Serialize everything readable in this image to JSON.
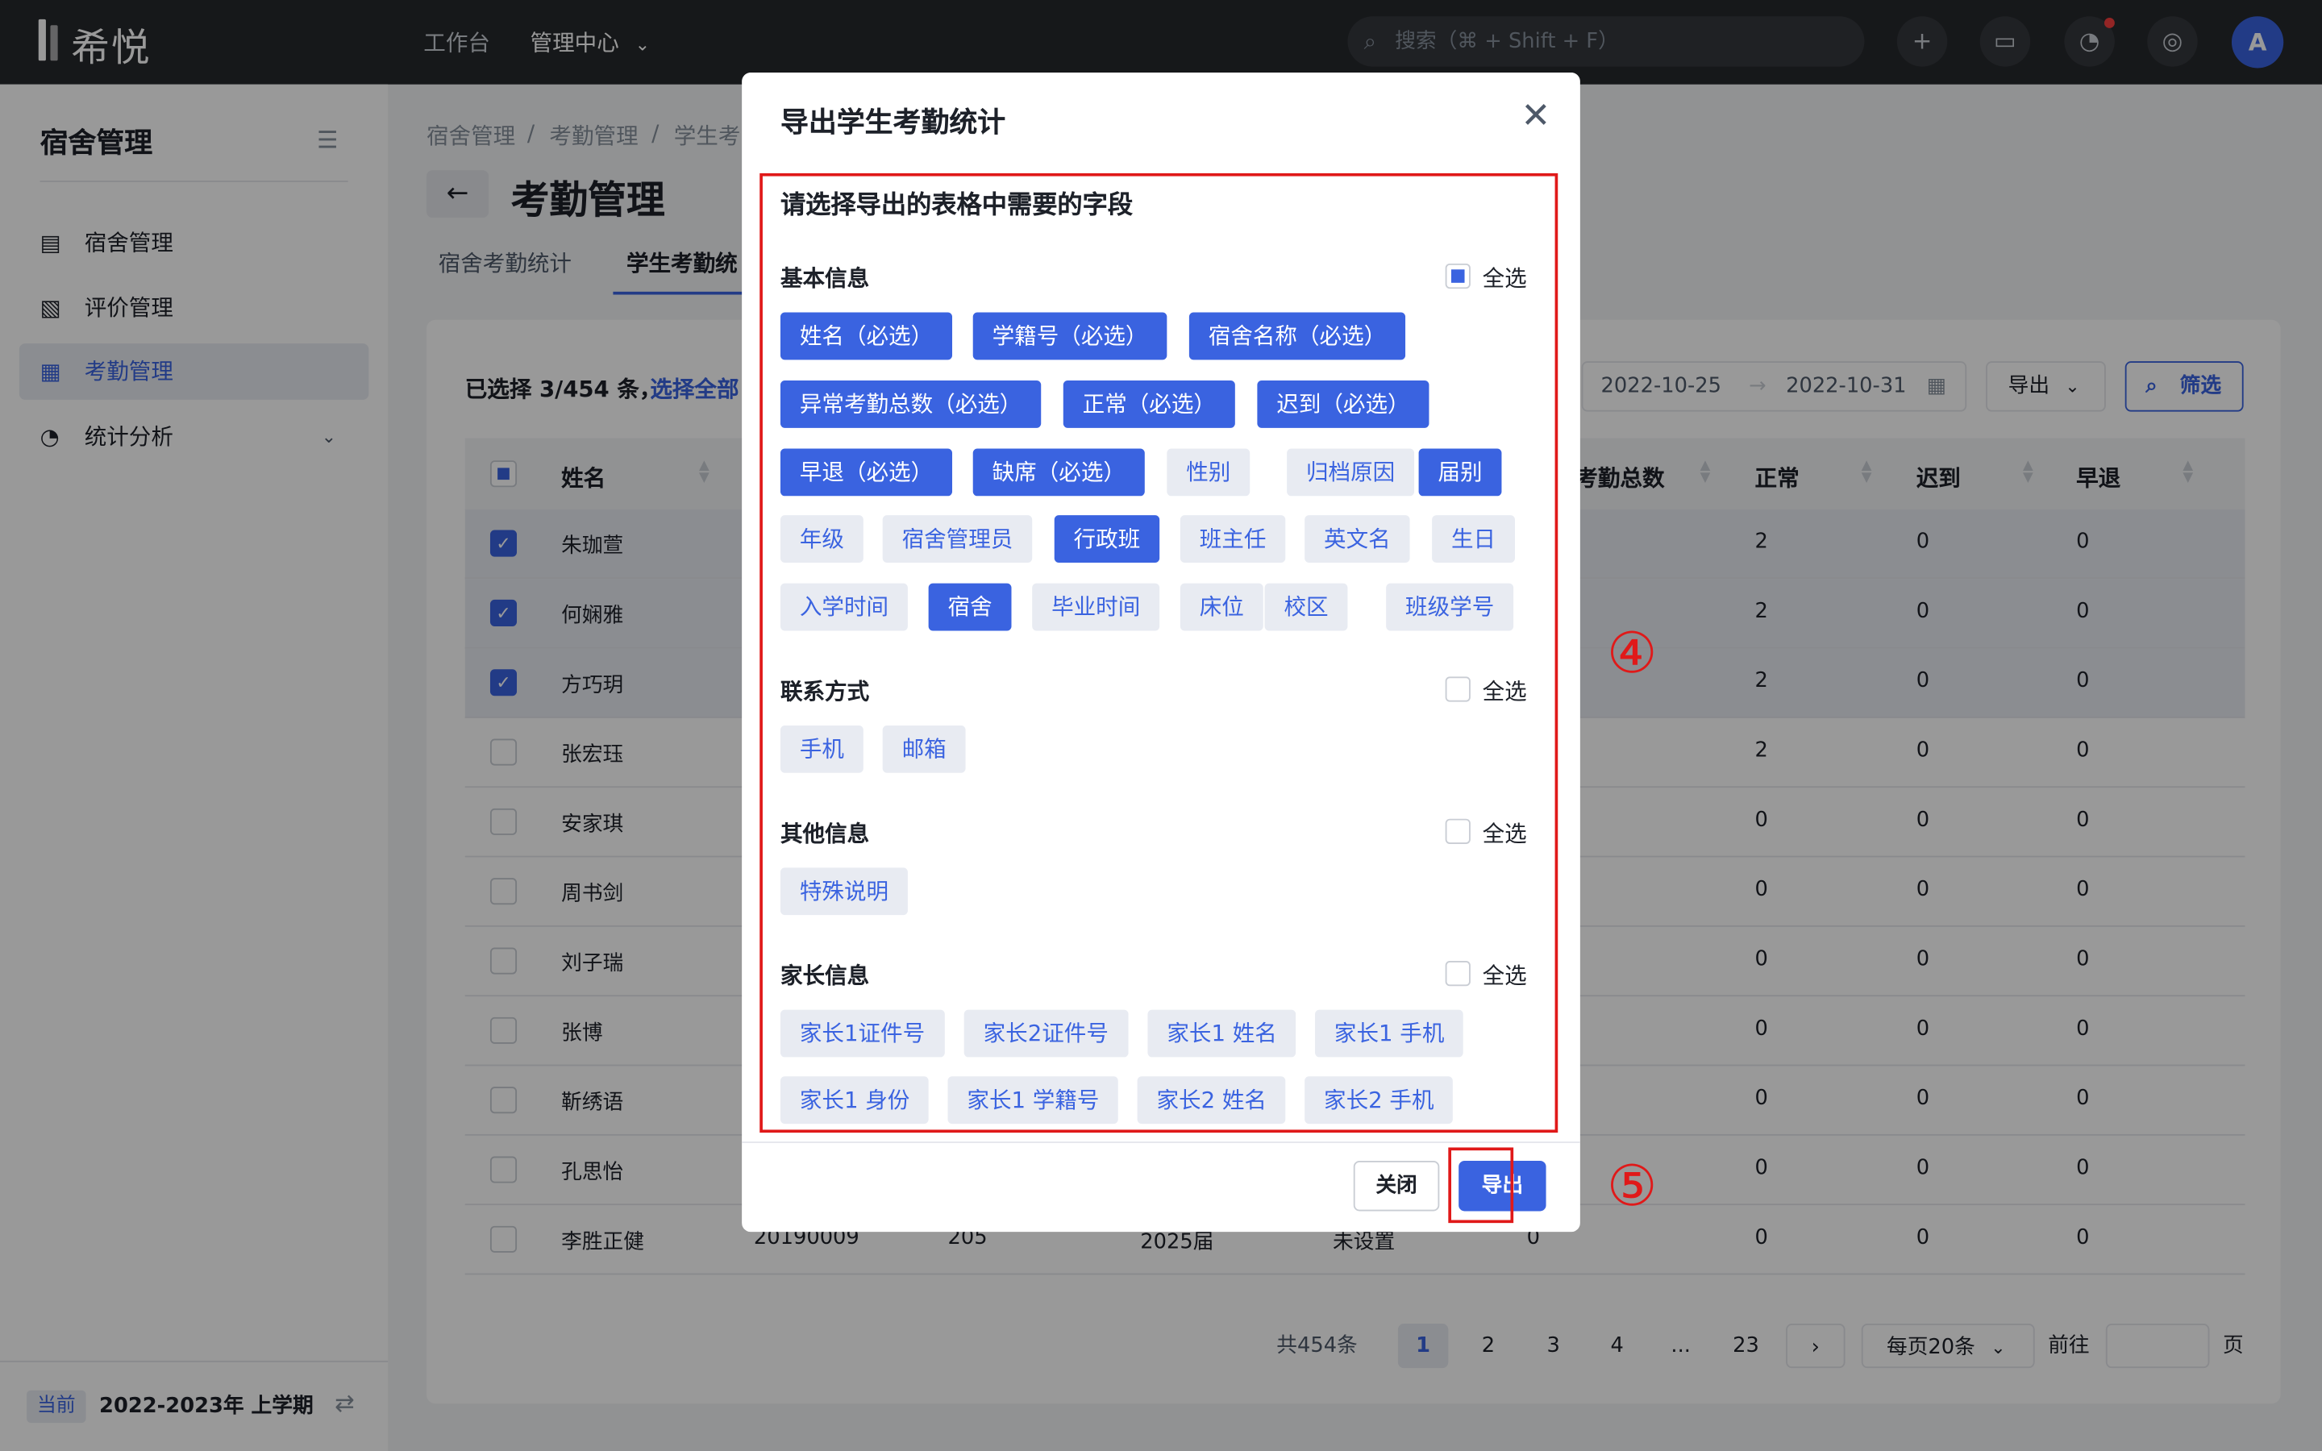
{
  "topbar": {
    "logo_text": "希悦",
    "nav": [
      {
        "label": "工作台"
      },
      {
        "label": "管理中心"
      }
    ],
    "search_placeholder": "搜索（⌘ + Shift + F）",
    "avatar": "A"
  },
  "sidebar": {
    "title": "宿舍管理",
    "items": [
      {
        "label": "宿舍管理",
        "icon": "bed-icon"
      },
      {
        "label": "评价管理",
        "icon": "document-chart-icon"
      },
      {
        "label": "考勤管理",
        "icon": "calendar-icon",
        "active": true
      },
      {
        "label": "统计分析",
        "icon": "pie-chart-icon"
      }
    ],
    "term_badge": "当前",
    "term": "2022-2023年 上学期"
  },
  "breadcrumb": [
    "宿舍管理",
    "考勤管理",
    "学生考"
  ],
  "page_title": "考勤管理",
  "tabs": [
    "宿舍考勤统计",
    "学生考勤统"
  ],
  "toolbar": {
    "selection": "已选择 3/454 条，",
    "select_all": "选择全部",
    "date_start": "2022-10-25",
    "date_sep": "→",
    "date_end": "2022-10-31",
    "export": "导出",
    "filter": "筛选"
  },
  "table": {
    "columns": [
      "姓名",
      "考勤总数",
      "正常",
      "迟到",
      "早退"
    ],
    "rows": [
      {
        "name": "朱珈萱",
        "selected": true,
        "normal": "2",
        "late": "0",
        "early": "0"
      },
      {
        "name": "何娴雅",
        "selected": true,
        "normal": "2",
        "late": "0",
        "early": "0"
      },
      {
        "name": "方巧玥",
        "selected": true,
        "normal": "2",
        "late": "0",
        "early": "0"
      },
      {
        "name": "张宏珏",
        "selected": false,
        "normal": "2",
        "late": "0",
        "early": "0"
      },
      {
        "name": "安家琪",
        "selected": false,
        "normal": "0",
        "late": "0",
        "early": "0"
      },
      {
        "name": "周书剑",
        "selected": false,
        "normal": "0",
        "late": "0",
        "early": "0"
      },
      {
        "name": "刘子瑞",
        "selected": false,
        "normal": "0",
        "late": "0",
        "early": "0"
      },
      {
        "name": "张博",
        "selected": false,
        "normal": "0",
        "late": "0",
        "early": "0"
      },
      {
        "name": "靳绣语",
        "selected": false,
        "normal": "0",
        "late": "0",
        "early": "0"
      },
      {
        "name": "孔思怡",
        "selected": false,
        "normal": "0",
        "late": "0",
        "early": "0"
      },
      {
        "name": "李胜正健",
        "selected": false,
        "id": "20190009",
        "room": "205",
        "grade": "2025届",
        "extra": "未设置",
        "total": "0",
        "normal": "0",
        "late": "0",
        "early": "0"
      }
    ]
  },
  "pagination": {
    "total": "共454条",
    "pages": [
      "1",
      "2",
      "3",
      "4",
      "...",
      "23"
    ],
    "page_size": "每页20条",
    "goto": "前往",
    "page_unit": "页"
  },
  "modal": {
    "title": "导出学生考勤统计",
    "hint": "请选择导出的表格中需要的字段",
    "select_all_label": "全选",
    "sections": [
      {
        "title": "基本信息",
        "fields": [
          {
            "label": "姓名（必选）",
            "on": true
          },
          {
            "label": "学籍号（必选）",
            "on": true
          },
          {
            "label": "宿舍名称（必选）",
            "on": true
          },
          {
            "label": "异常考勤总数（必选）",
            "on": true
          },
          {
            "label": "正常（必选）",
            "on": true
          },
          {
            "label": "迟到（必选）",
            "on": true
          },
          {
            "label": "早退（必选）",
            "on": true
          },
          {
            "label": "缺席（必选）",
            "on": true
          },
          {
            "label": "性别",
            "on": false
          },
          {
            "label": "归档原因",
            "on": false
          },
          {
            "label": "届别",
            "on": true
          },
          {
            "label": "年级",
            "on": false
          },
          {
            "label": "宿舍管理员",
            "on": false
          },
          {
            "label": "行政班",
            "on": true
          },
          {
            "label": "班主任",
            "on": false
          },
          {
            "label": "英文名",
            "on": false
          },
          {
            "label": "生日",
            "on": false
          },
          {
            "label": "入学时间",
            "on": false
          },
          {
            "label": "宿舍",
            "on": true
          },
          {
            "label": "毕业时间",
            "on": false
          },
          {
            "label": "床位",
            "on": false
          },
          {
            "label": "校区",
            "on": false
          },
          {
            "label": "班级学号",
            "on": false
          }
        ]
      },
      {
        "title": "联系方式",
        "fields": [
          {
            "label": "手机",
            "on": false
          },
          {
            "label": "邮箱",
            "on": false
          }
        ]
      },
      {
        "title": "其他信息",
        "fields": [
          {
            "label": "特殊说明",
            "on": false
          }
        ]
      },
      {
        "title": "家长信息",
        "fields": [
          {
            "label": "家长1证件号",
            "on": false
          },
          {
            "label": "家长2证件号",
            "on": false
          },
          {
            "label": "家长1 姓名",
            "on": false
          },
          {
            "label": "家长1 手机",
            "on": false
          },
          {
            "label": "家长1 身份",
            "on": false
          },
          {
            "label": "家长1 学籍号",
            "on": false
          },
          {
            "label": "家长2 姓名",
            "on": false
          },
          {
            "label": "家长2 手机",
            "on": false
          }
        ]
      }
    ],
    "close_label": "关闭",
    "export_label": "导出"
  },
  "annotations": {
    "step4": "④",
    "step5": "⑤"
  },
  "colors": {
    "accent": "#3a63e0",
    "annotation": "#e01919",
    "topbar": "#26282c"
  }
}
